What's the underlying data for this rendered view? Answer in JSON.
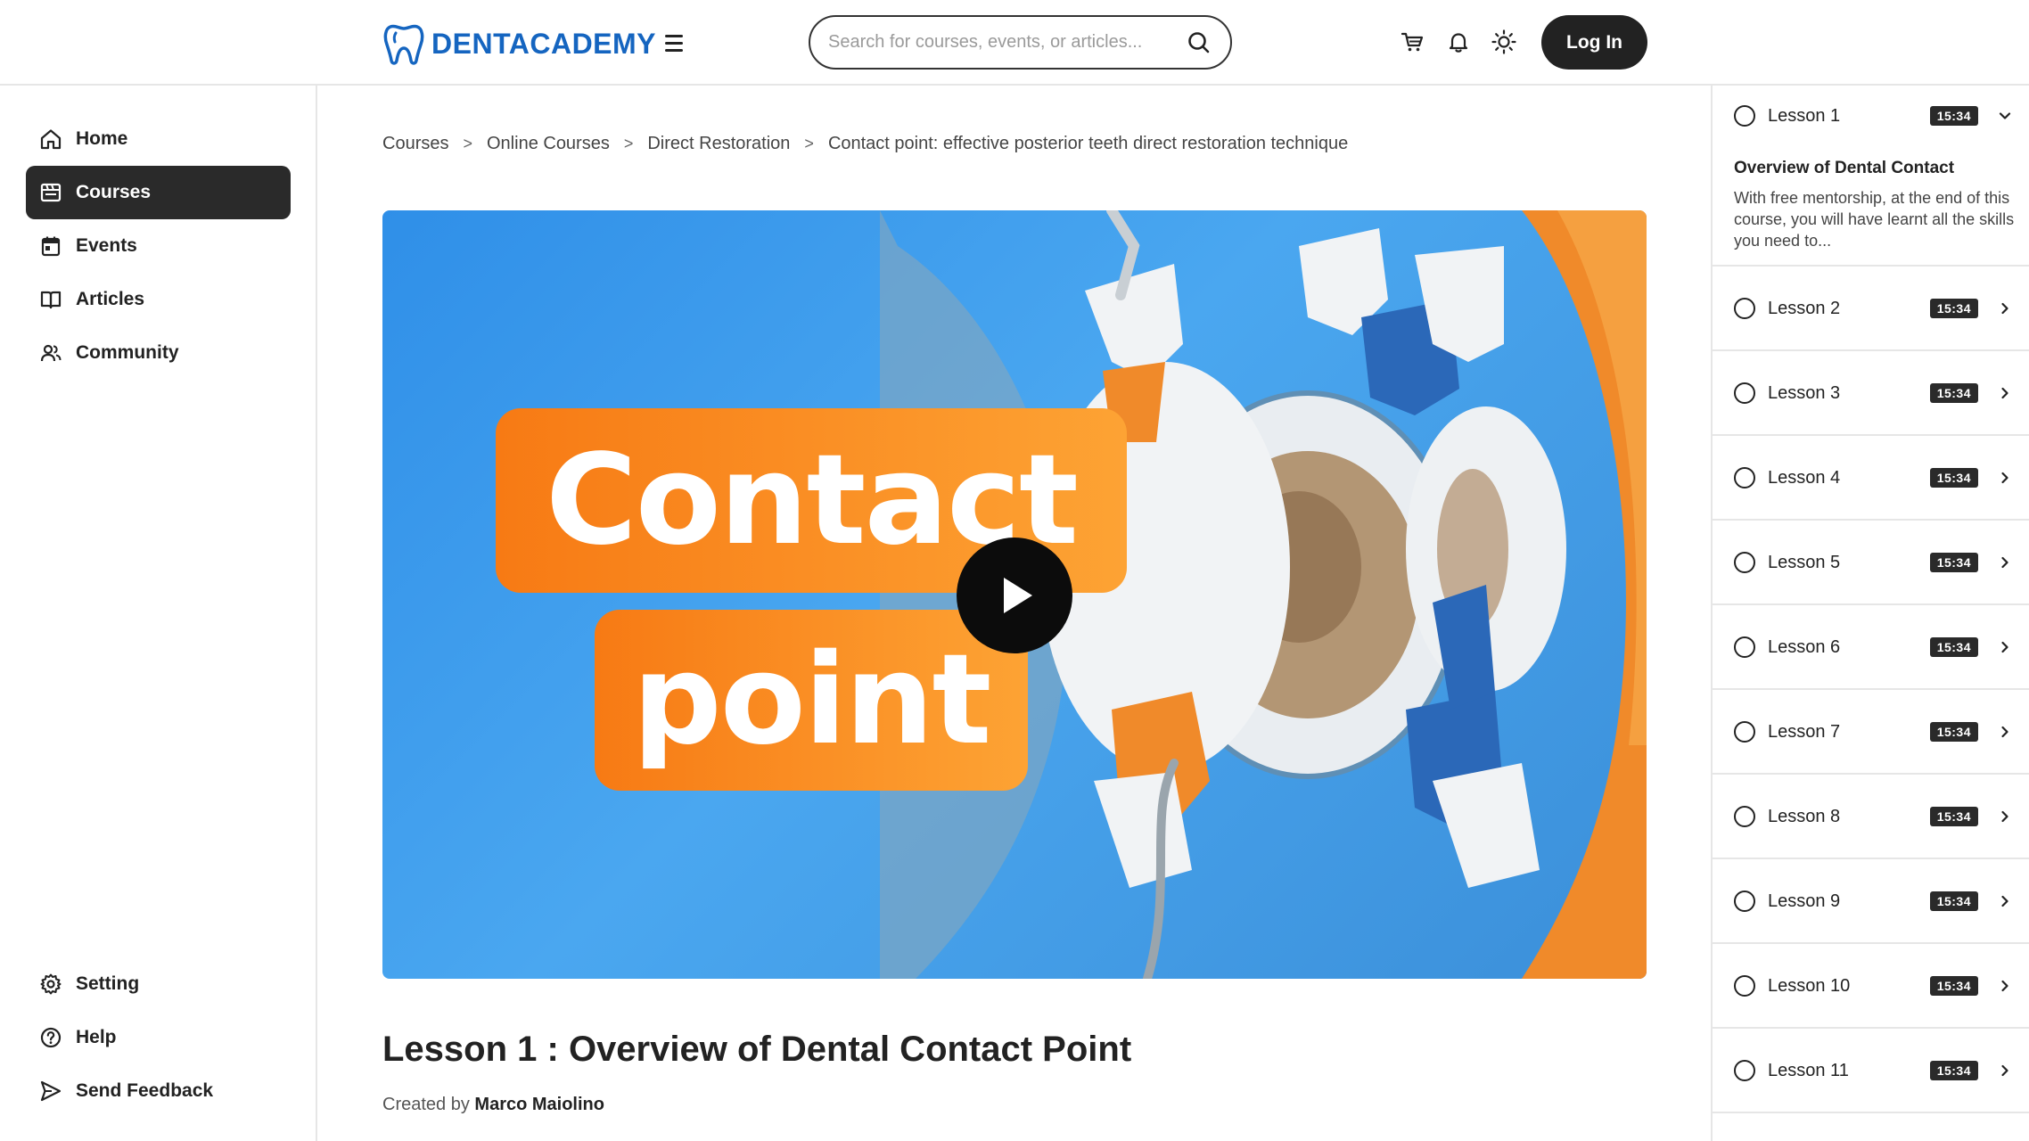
{
  "brand": {
    "name": "DENTACADEMY",
    "color": "#1565c0"
  },
  "header": {
    "search_placeholder": "Search for courses, events, or articles...",
    "login_label": "Log In",
    "icons": [
      "menu-icon",
      "search-icon",
      "cart-icon",
      "bell-icon",
      "sun-icon"
    ]
  },
  "sidebar": {
    "items": [
      {
        "label": "Home",
        "icon": "home-icon"
      },
      {
        "label": "Courses",
        "icon": "courses-icon",
        "active": true
      },
      {
        "label": "Events",
        "icon": "calendar-icon"
      },
      {
        "label": "Articles",
        "icon": "book-icon"
      },
      {
        "label": "Community",
        "icon": "users-icon"
      }
    ],
    "bottom_items": [
      {
        "label": "Setting",
        "icon": "gear-icon"
      },
      {
        "label": "Help",
        "icon": "help-icon"
      },
      {
        "label": "Send Feedback",
        "icon": "send-icon"
      }
    ]
  },
  "breadcrumb": {
    "items": [
      "Courses",
      "Online Courses",
      "Direct Restoration",
      "Contact point: effective posterior teeth direct restoration technique"
    ],
    "separator": ">"
  },
  "video": {
    "title_line_1": "Contact",
    "title_line_2": "point",
    "play_icon": "play-icon"
  },
  "lesson": {
    "title": "Lesson 1 : Overview of Dental Contact Point",
    "created_by_label": "Created by",
    "author": "Marco Maiolino"
  },
  "lessons_panel": {
    "expanded": {
      "name": "Lesson 1",
      "duration": "15:34",
      "detail_title": "Overview of Dental Contact",
      "detail_description": "With free mentorship, at the end of this course, you will have learnt all the skills you need to..."
    },
    "items": [
      {
        "name": "Lesson 2",
        "duration": "15:34"
      },
      {
        "name": "Lesson 3",
        "duration": "15:34"
      },
      {
        "name": "Lesson 4",
        "duration": "15:34"
      },
      {
        "name": "Lesson 5",
        "duration": "15:34"
      },
      {
        "name": "Lesson 6",
        "duration": "15:34"
      },
      {
        "name": "Lesson 7",
        "duration": "15:34"
      },
      {
        "name": "Lesson 8",
        "duration": "15:34"
      },
      {
        "name": "Lesson 9",
        "duration": "15:34"
      },
      {
        "name": "Lesson 10",
        "duration": "15:34"
      },
      {
        "name": "Lesson 11",
        "duration": "15:34"
      }
    ]
  }
}
